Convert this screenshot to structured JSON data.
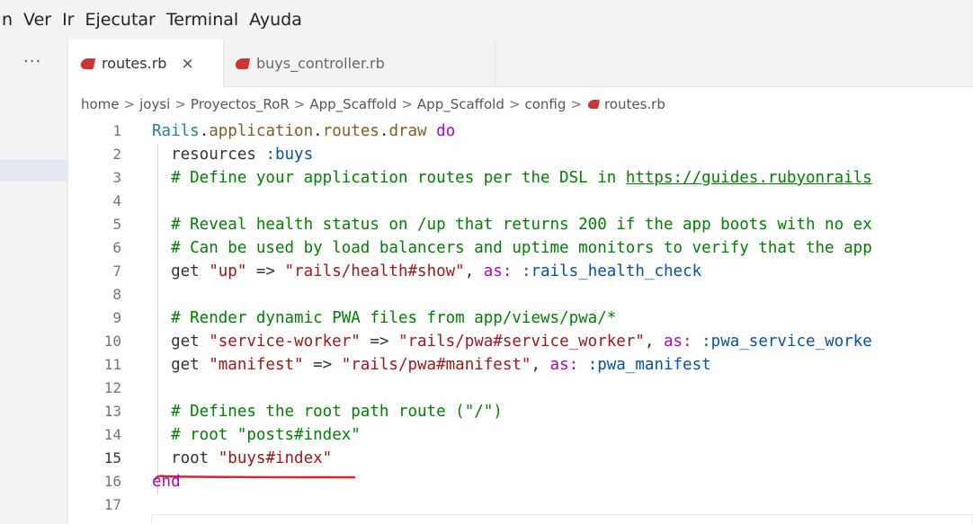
{
  "menu": [
    "n",
    "Ver",
    "Ir",
    "Ejecutar",
    "Terminal",
    "Ayuda"
  ],
  "sidebar": {
    "more_label": "···"
  },
  "tabs": [
    {
      "label": "routes.rb",
      "active": true,
      "close": "×"
    },
    {
      "label": "buys_controller.rb",
      "active": false
    }
  ],
  "breadcrumb": [
    "home",
    "joysi",
    "Proyectos_RoR",
    "App_Scaffold",
    "App_Scaffold",
    "config",
    "routes.rb"
  ],
  "breadcrumb_sep": ">",
  "code_lines": [
    {
      "n": "1",
      "tokens": [
        [
          "const",
          "Rails"
        ],
        [
          "plain",
          "."
        ],
        [
          "meth",
          "application"
        ],
        [
          "plain",
          "."
        ],
        [
          "meth",
          "routes"
        ],
        [
          "plain",
          "."
        ],
        [
          "meth",
          "draw"
        ],
        [
          "plain",
          " "
        ],
        [
          "kw",
          "do"
        ]
      ]
    },
    {
      "n": "2",
      "tokens": [
        [
          "plain",
          "  resources "
        ],
        [
          "sym",
          ":buys"
        ]
      ]
    },
    {
      "n": "3",
      "tokens": [
        [
          "plain",
          "  "
        ],
        [
          "cmt",
          "# Define your application routes per the DSL in "
        ],
        [
          "link",
          "https://guides.rubyonrails"
        ]
      ]
    },
    {
      "n": "4",
      "tokens": []
    },
    {
      "n": "5",
      "tokens": [
        [
          "plain",
          "  "
        ],
        [
          "cmt",
          "# Reveal health status on /up that returns 200 if the app boots with no ex"
        ]
      ]
    },
    {
      "n": "6",
      "tokens": [
        [
          "plain",
          "  "
        ],
        [
          "cmt",
          "# Can be used by load balancers and uptime monitors to verify that the app"
        ]
      ]
    },
    {
      "n": "7",
      "tokens": [
        [
          "plain",
          "  get "
        ],
        [
          "str",
          "\"up\""
        ],
        [
          "plain",
          " => "
        ],
        [
          "str",
          "\"rails/health#show\""
        ],
        [
          "plain",
          ", "
        ],
        [
          "kw",
          "as:"
        ],
        [
          "plain",
          " "
        ],
        [
          "sym",
          ":rails_health_check"
        ]
      ]
    },
    {
      "n": "8",
      "tokens": []
    },
    {
      "n": "9",
      "tokens": [
        [
          "plain",
          "  "
        ],
        [
          "cmt",
          "# Render dynamic PWA files from app/views/pwa/*"
        ]
      ]
    },
    {
      "n": "10",
      "tokens": [
        [
          "plain",
          "  get "
        ],
        [
          "str",
          "\"service-worker\""
        ],
        [
          "plain",
          " => "
        ],
        [
          "str",
          "\"rails/pwa#service_worker\""
        ],
        [
          "plain",
          ", "
        ],
        [
          "kw",
          "as:"
        ],
        [
          "plain",
          " "
        ],
        [
          "sym",
          ":pwa_service_worke"
        ]
      ]
    },
    {
      "n": "11",
      "tokens": [
        [
          "plain",
          "  get "
        ],
        [
          "str",
          "\"manifest\""
        ],
        [
          "plain",
          " => "
        ],
        [
          "str",
          "\"rails/pwa#manifest\""
        ],
        [
          "plain",
          ", "
        ],
        [
          "kw",
          "as:"
        ],
        [
          "plain",
          " "
        ],
        [
          "sym",
          ":pwa_manifest"
        ]
      ]
    },
    {
      "n": "12",
      "tokens": []
    },
    {
      "n": "13",
      "tokens": [
        [
          "plain",
          "  "
        ],
        [
          "cmt",
          "# Defines the root path route (\"/\")"
        ]
      ]
    },
    {
      "n": "14",
      "tokens": [
        [
          "plain",
          "  "
        ],
        [
          "cmt",
          "# root \"posts#index\""
        ]
      ]
    },
    {
      "n": "15",
      "tokens": [
        [
          "plain",
          "  root "
        ],
        [
          "str",
          "\"buys#index\""
        ]
      ]
    },
    {
      "n": "16",
      "tokens": [
        [
          "kw",
          "end"
        ]
      ]
    },
    {
      "n": "17",
      "tokens": []
    }
  ],
  "colors": {
    "ruby_icon": "#cc3534",
    "annotation": "#e0241b",
    "comment": "#008000",
    "string": "#a31515",
    "keyword": "#af00db",
    "symbol": "#0451a5"
  }
}
